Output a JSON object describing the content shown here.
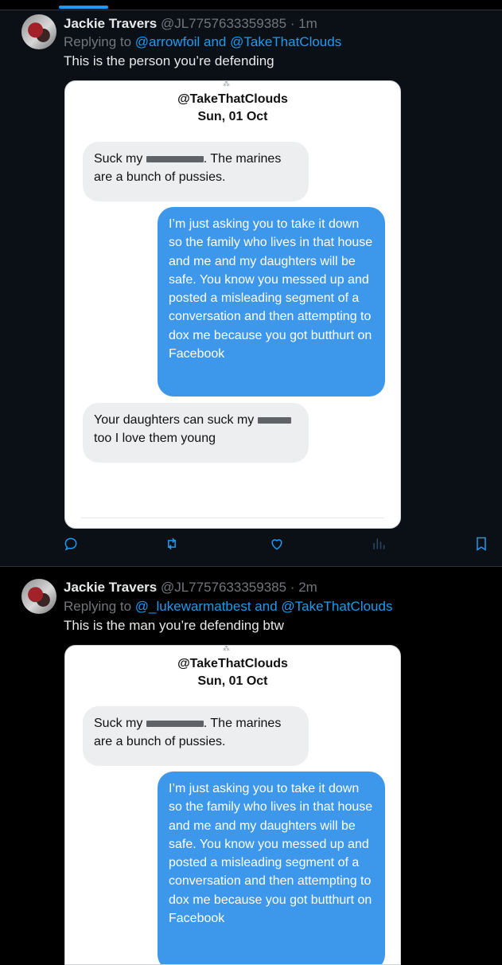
{
  "tweets": [
    {
      "author": "Jackie Travers",
      "handle": "@JL7757633359385",
      "time": "· 1m",
      "replying_prefix": "Replying to",
      "replying_to": "@arrowfoil and @TakeThatClouds",
      "text": "This is the person you’re defending",
      "screenshot": {
        "title": "@TakeThatClouds",
        "date": "Sun, 01 Oct",
        "messages": [
          {
            "side": "received",
            "line1_pre": "Suck my",
            "line1_post": ". The marines",
            "line2": "are a bunch of pussies."
          },
          {
            "side": "sent",
            "text": "I’m just asking you to take it down so the family who lives in that house and me and my daughters will be safe. You know you messed up and posted a misleading segment of a conversation and then attempting to dox me because you got butthurt on Facebook"
          },
          {
            "side": "received",
            "line1_pre": "Your daughters can suck my",
            "line2": "too I love them young"
          }
        ]
      }
    },
    {
      "author": "Jackie Travers",
      "handle": "@JL7757633359385",
      "time": "· 2m",
      "replying_prefix": "Replying to",
      "replying_to": "@_lukewarmatbest and @TakeThatClouds",
      "text": "This is the man you’re defending btw",
      "screenshot": {
        "title": "@TakeThatClouds",
        "date": "Sun, 01 Oct",
        "messages": [
          {
            "side": "received",
            "line1_pre": "Suck my",
            "line1_post": ". The marines",
            "line2": "are a bunch of pussies."
          },
          {
            "side": "sent",
            "text": "I’m just asking you to take it down so the family who lives in that house and me and my daughters will be safe. You know you messed up and posted a misleading segment of a conversation and then attempting to dox me because you got butthurt on Facebook"
          }
        ]
      }
    }
  ],
  "actions": [
    "reply-icon",
    "retweet-icon",
    "like-icon",
    "views-icon",
    "bookmark-icon"
  ],
  "colors": {
    "accent": "#1d9bf0",
    "sent_bubble": "#3d97ea",
    "received_bubble": "#eceef0",
    "muted": "#71767b"
  }
}
